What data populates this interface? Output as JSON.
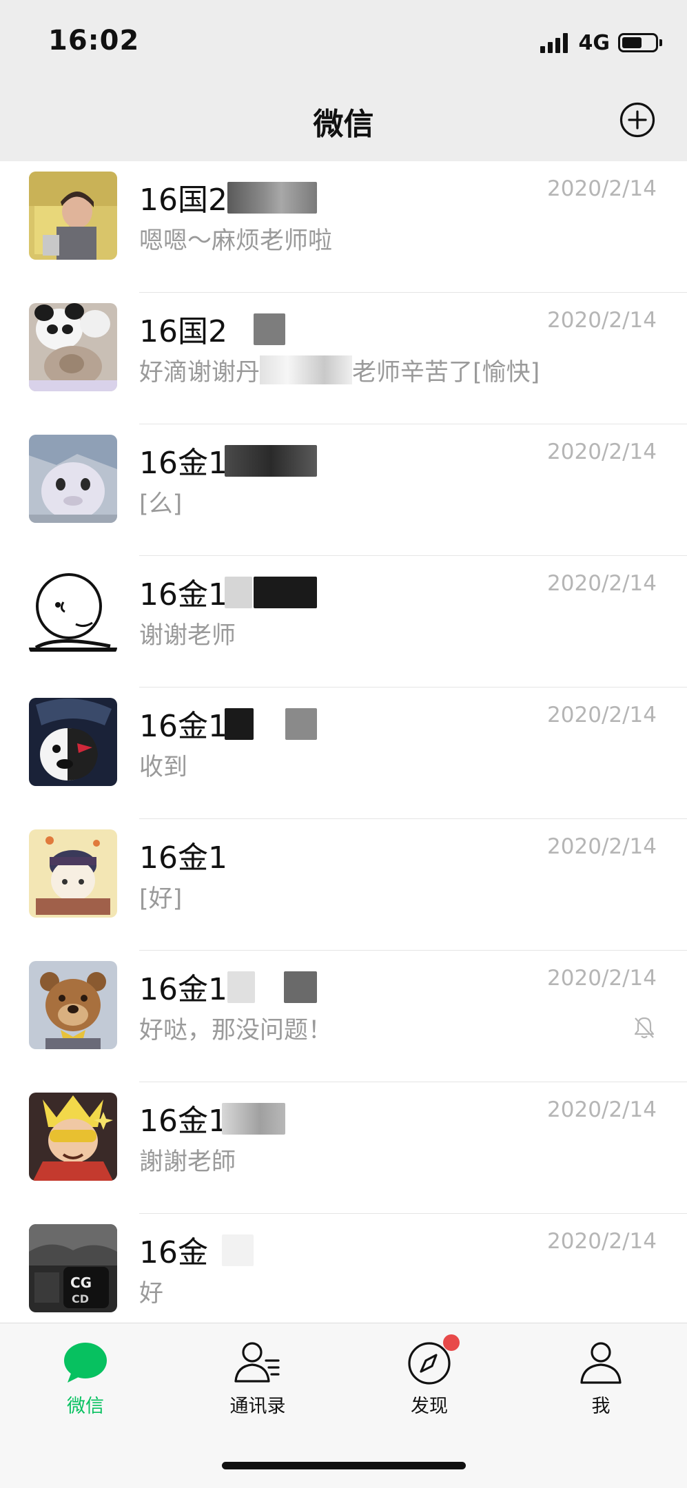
{
  "status_bar": {
    "time": "16:02",
    "network": "4G"
  },
  "header": {
    "title": "微信",
    "add_icon": "plus-circle-icon"
  },
  "chats": [
    {
      "name": "16国2",
      "time": "2020/2/14",
      "preview": "嗯嗯～麻烦老师啦",
      "muted": false
    },
    {
      "name": "16国2",
      "time": "2020/2/14",
      "preview": "好滴谢谢丹",
      "preview_tail": "老师辛苦了[愉快]",
      "muted": false
    },
    {
      "name": "16金1",
      "time": "2020/2/14",
      "preview": "[么]",
      "muted": false
    },
    {
      "name": "16金1",
      "time": "2020/2/14",
      "preview": "谢谢老师",
      "muted": false
    },
    {
      "name": "16金1",
      "time": "2020/2/14",
      "preview": "收到",
      "muted": false
    },
    {
      "name": "16金1",
      "time": "2020/2/14",
      "preview": "[好]",
      "muted": false
    },
    {
      "name": "16金1",
      "time": "2020/2/14",
      "preview": "好哒，那没问题！",
      "muted": true
    },
    {
      "name": "16金1",
      "time": "2020/2/14",
      "preview": "謝謝老師",
      "muted": false
    },
    {
      "name": "16金",
      "time": "2020/2/14",
      "preview": "好",
      "muted": false
    }
  ],
  "tabs": [
    {
      "label": "微信",
      "icon": "chat-bubble-icon",
      "active": true
    },
    {
      "label": "通讯录",
      "icon": "contacts-icon",
      "active": false
    },
    {
      "label": "发现",
      "icon": "compass-icon",
      "active": false,
      "badge": true
    },
    {
      "label": "我",
      "icon": "person-icon",
      "active": false
    }
  ],
  "colors": {
    "accent": "#07c160",
    "badge": "#e84a4a",
    "header_bg": "#ededed",
    "time_text": "#b5b5b5",
    "preview_text": "#9a9a9a"
  }
}
